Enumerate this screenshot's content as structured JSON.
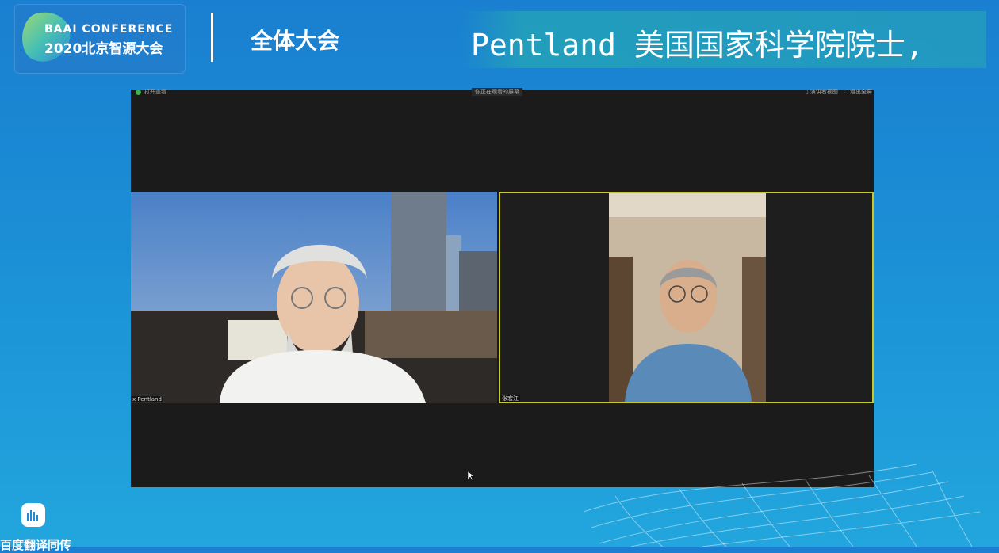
{
  "header": {
    "logo_line1": "BAAI CONFERENCE",
    "logo_line2": "2020北京智源大会",
    "session_title": "全体大会"
  },
  "subtitle": {
    "text": "Pentland 美国国家科学院院士,"
  },
  "meeting": {
    "toolbar_left": "打开查看",
    "toolbar_center": "你正在观看的屏幕",
    "toolbar_right_1": "▯ 演讲者视图",
    "toolbar_right_2": "⛶ 退出全屏",
    "participants": [
      {
        "name": "x Pentland"
      },
      {
        "name": "张宏江"
      }
    ]
  },
  "footer": {
    "brand_text": "百度翻译同传"
  },
  "colors": {
    "background": "#1b8fd6",
    "active_speaker_border": "#c8c82e",
    "video_bg": "#1b1b1c"
  }
}
